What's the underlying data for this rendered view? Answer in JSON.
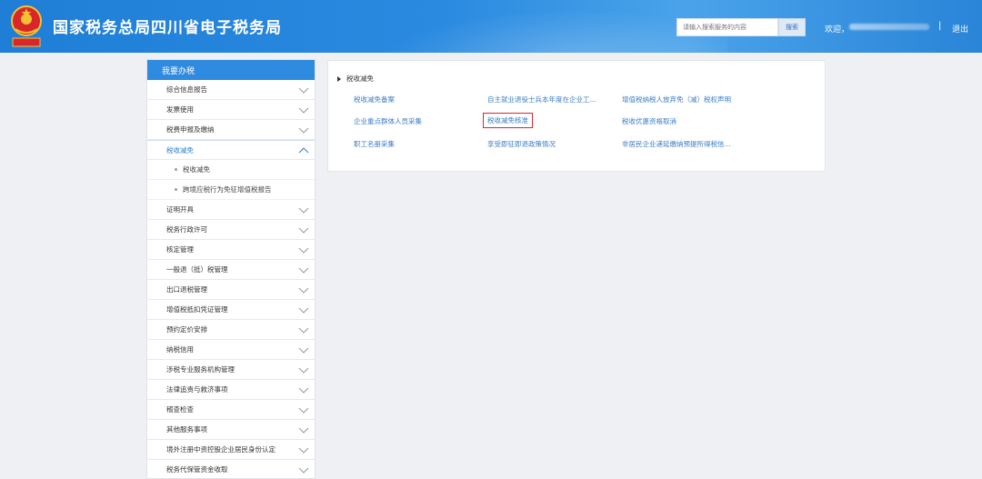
{
  "header": {
    "site_title": "国家税务总局四川省电子税务局",
    "search_placeholder": "请输入搜索服务的内容",
    "search_button": "搜索",
    "welcome": "欢迎，",
    "separator": "|",
    "logout": "退出",
    "brand_colors": {
      "primary": "#1f7ed6",
      "accent": "#2f8be0"
    }
  },
  "sidebar": {
    "title": "我要办税",
    "items": [
      {
        "label": "综合信息报告"
      },
      {
        "label": "发票使用"
      },
      {
        "label": "税费申报及缴纳"
      },
      {
        "label": "税收减免",
        "active": true,
        "children": [
          {
            "label": "税收减免"
          },
          {
            "label": "跨境应税行为免征增值税报告"
          }
        ]
      },
      {
        "label": "证明开具"
      },
      {
        "label": "税务行政许可"
      },
      {
        "label": "核定管理"
      },
      {
        "label": "一般退（抵）税管理"
      },
      {
        "label": "出口退税管理"
      },
      {
        "label": "增值税抵扣凭证管理"
      },
      {
        "label": "预约定价安排"
      },
      {
        "label": "纳税信用"
      },
      {
        "label": "涉税专业服务机构管理"
      },
      {
        "label": "法律追责与救济事项"
      },
      {
        "label": "稽查检查"
      },
      {
        "label": "其他服务事项"
      },
      {
        "label": "境外注册中资控股企业居民身份认定"
      },
      {
        "label": "税务代保管资金收取"
      }
    ]
  },
  "panel": {
    "title": "税收减免",
    "links": [
      {
        "label": "税收减免备案"
      },
      {
        "label": "自主就业退役士兵本年度在企业工..."
      },
      {
        "label": "增值税纳税人放弃免（减）税权声明"
      },
      {
        "label": "企业重点群体人员采集"
      },
      {
        "label": "税收减免核准",
        "highlighted": true
      },
      {
        "label": "税收优惠资格取消"
      },
      {
        "label": "职工名册采集"
      },
      {
        "label": "享受即征即退政策情况"
      },
      {
        "label": "非居民企业递延缴纳预提所得税信..."
      }
    ]
  }
}
